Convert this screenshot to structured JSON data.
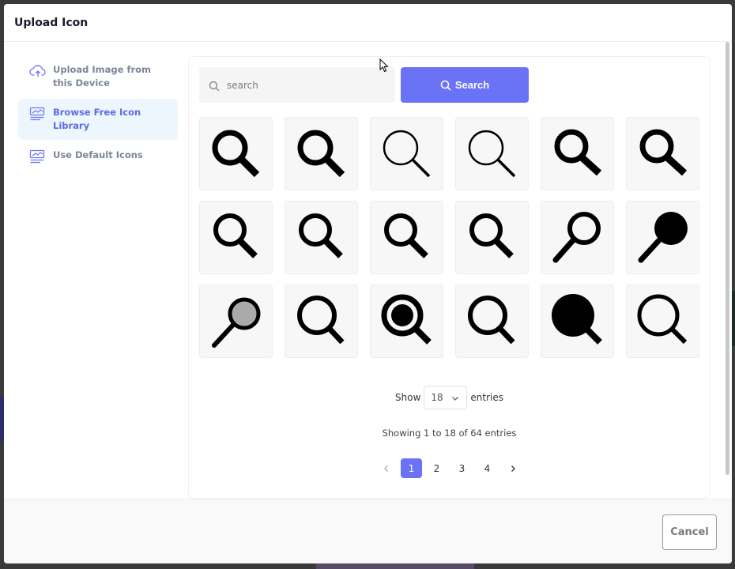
{
  "modal": {
    "title": "Upload Icon"
  },
  "sidebar": {
    "items": [
      {
        "label": "Upload Image from this Device",
        "icon": "cloud-upload-icon",
        "active": false
      },
      {
        "label": "Browse Free Icon Library",
        "icon": "library-icon",
        "active": true
      },
      {
        "label": "Use Default Icons",
        "icon": "default-icons-icon",
        "active": false
      }
    ]
  },
  "search": {
    "placeholder": "search",
    "value": "",
    "button_label": "Search"
  },
  "icons": [
    "magnifier-bold-icon",
    "magnifier-bold-icon",
    "magnifier-thin-icon",
    "magnifier-thin-icon",
    "magnifier-bold-icon",
    "magnifier-bold-icon",
    "magnifier-icon",
    "magnifier-icon",
    "magnifier-icon",
    "magnifier-icon",
    "magnifier-long-handle-icon",
    "magnifier-filled-icon",
    "magnifier-gray-lens-icon",
    "magnifier-large-icon",
    "magnifier-ring-icon",
    "magnifier-large-icon",
    "magnifier-solid-large-icon",
    "magnifier-outline-large-icon"
  ],
  "entries": {
    "show_label": "Show",
    "value": "18",
    "suffix": "entries"
  },
  "showing_text": "Showing 1 to 18 of 64 entries",
  "pagination": {
    "pages": [
      "1",
      "2",
      "3",
      "4"
    ],
    "current": "1"
  },
  "footer": {
    "cancel_label": "Cancel"
  },
  "colors": {
    "accent": "#6a73f5",
    "active_bg": "#eef6fd"
  }
}
